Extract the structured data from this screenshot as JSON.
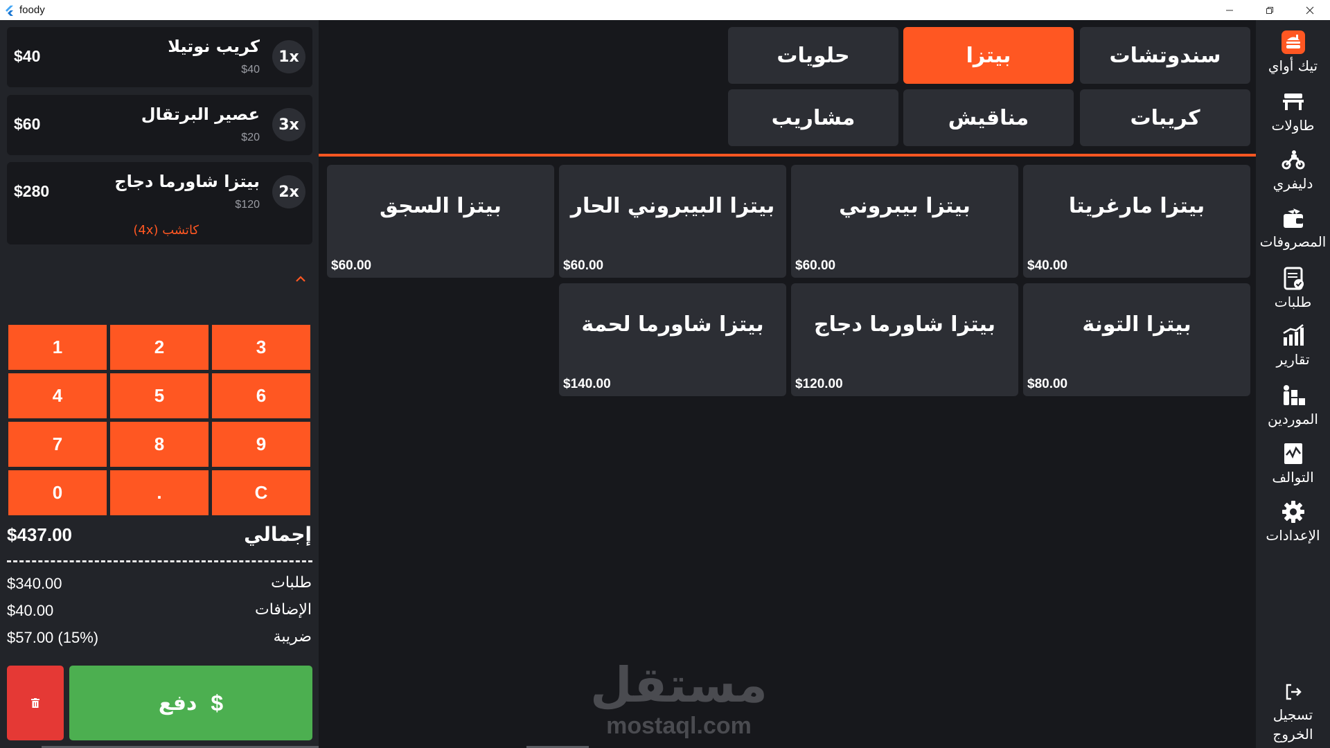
{
  "window": {
    "title": "foody"
  },
  "order": {
    "items": [
      {
        "qty": "1x",
        "name": "كريب نوتيلا",
        "unit_price": "$40",
        "total": "$40",
        "addons": ""
      },
      {
        "qty": "3x",
        "name": "عصير البرتقال",
        "unit_price": "$20",
        "total": "$60",
        "addons": ""
      },
      {
        "qty": "2x",
        "name": "بيتزا شاورما دجاج",
        "unit_price": "$120",
        "total": "$280",
        "addons": "كاتشب (4x)"
      }
    ]
  },
  "keypad": {
    "keys": [
      "1",
      "2",
      "3",
      "4",
      "5",
      "6",
      "7",
      "8",
      "9",
      "0",
      ".",
      "C"
    ]
  },
  "summary": {
    "total_label": "إجمالي",
    "total_value": "$437.00",
    "rows": [
      {
        "label": "طلبات",
        "value": "$340.00"
      },
      {
        "label": "الإضافات",
        "value": "$40.00"
      },
      {
        "label": "ضريبة",
        "value": "$57.00 (15%)"
      }
    ]
  },
  "actions": {
    "pay_label": "دفع",
    "pay_icon": "dollar-icon",
    "delete_icon": "trash-icon"
  },
  "categories": [
    {
      "label": "سندوتشات",
      "active": false
    },
    {
      "label": "بيتزا",
      "active": true
    },
    {
      "label": "حلويات",
      "active": false
    },
    {
      "label": "كريبات",
      "active": false
    },
    {
      "label": "مناقيش",
      "active": false
    },
    {
      "label": "مشاريب",
      "active": false
    }
  ],
  "products": [
    {
      "name": "بيتزا مارغريتا",
      "price": "$40.00"
    },
    {
      "name": "بيتزا بيبروني",
      "price": "$60.00"
    },
    {
      "name": "بيتزا البيبروني الحار",
      "price": "$60.00"
    },
    {
      "name": "بيتزا السجق",
      "price": "$60.00"
    },
    {
      "name": "بيتزا التونة",
      "price": "$80.00"
    },
    {
      "name": "بيتزا شاورما دجاج",
      "price": "$120.00"
    },
    {
      "name": "بيتزا شاورما لحمة",
      "price": "$140.00"
    }
  ],
  "watermark": {
    "arabic": "مستقل",
    "latin": "mostaql.com"
  },
  "nav": [
    {
      "label": "تيك أواي",
      "icon": "takeaway-icon"
    },
    {
      "label": "طاولات",
      "icon": "table-icon"
    },
    {
      "label": "دليفري",
      "icon": "delivery-icon"
    },
    {
      "label": "المصروفات",
      "icon": "wallet-icon"
    },
    {
      "label": "طلبات",
      "icon": "orders-icon"
    },
    {
      "label": "تقارير",
      "icon": "reports-icon"
    },
    {
      "label": "الموردين",
      "icon": "suppliers-icon"
    },
    {
      "label": "التوالف",
      "icon": "damaged-icon"
    },
    {
      "label": "الإعدادات",
      "icon": "gear-icon"
    }
  ],
  "logout": {
    "label_line1": "تسجيل",
    "label_line2": "الخروج",
    "icon": "logout-icon"
  },
  "colors": {
    "accent": "#ff5722",
    "pay": "#4caf50",
    "delete": "#e53935",
    "panel": "#222429",
    "card": "#2c2e34",
    "background": "#17181c"
  }
}
